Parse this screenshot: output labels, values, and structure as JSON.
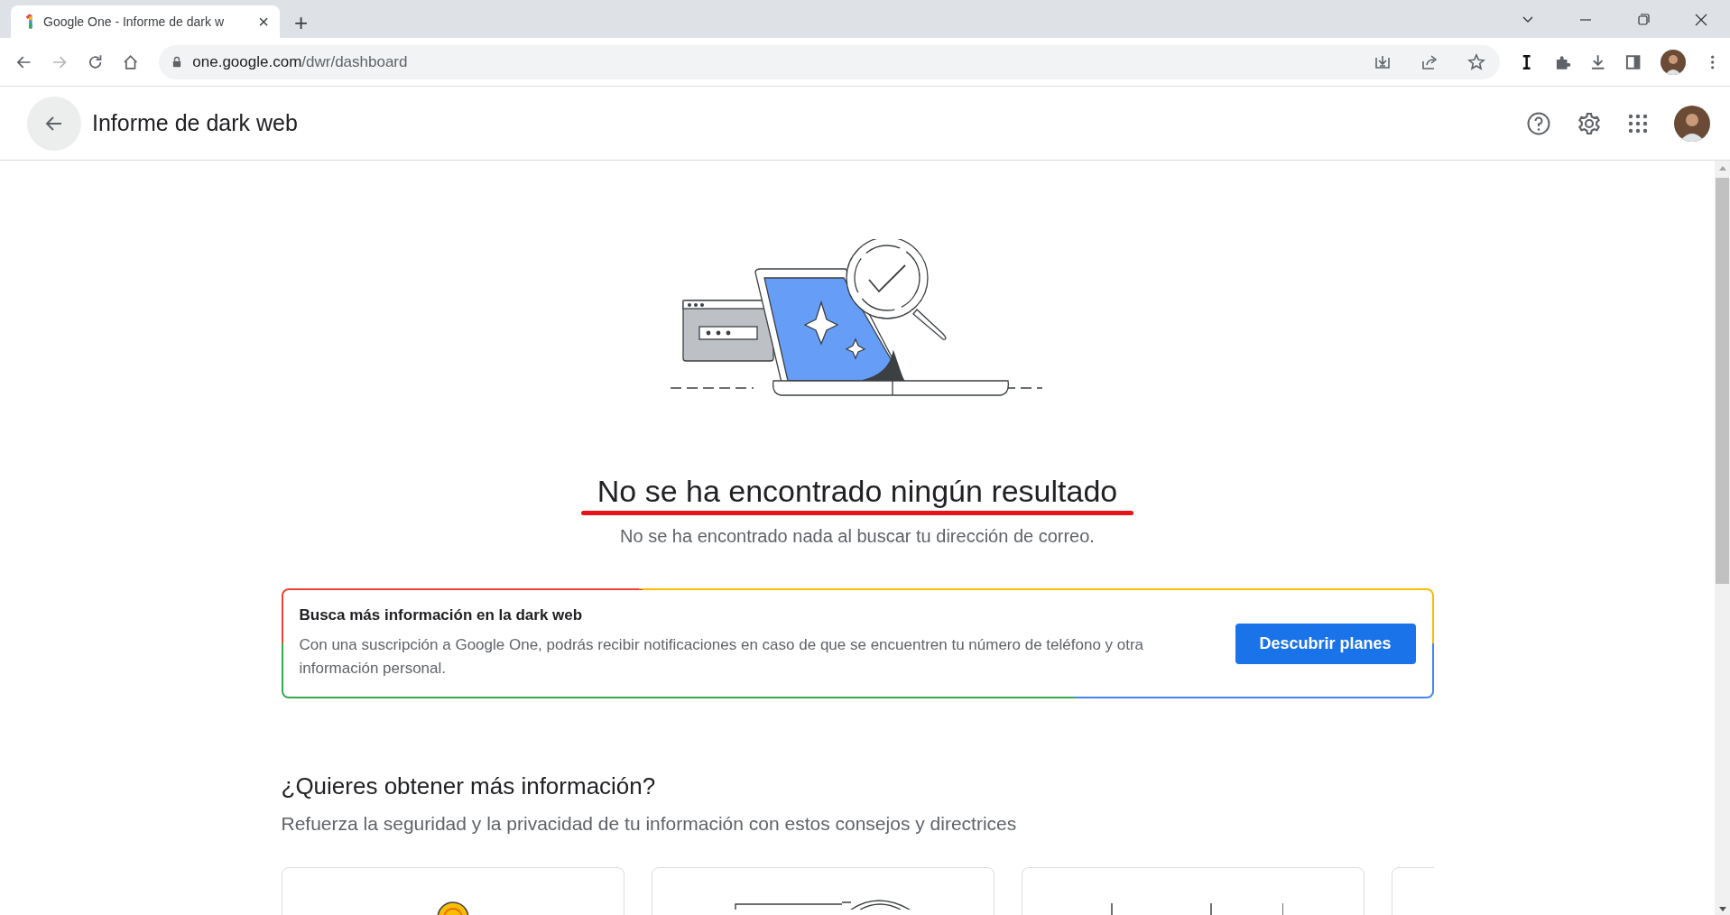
{
  "browser": {
    "tab": {
      "title": "Google One - Informe de dark w",
      "close": "×",
      "selected": true
    },
    "new_tab": "+",
    "url": {
      "domain": "one.google.com",
      "path": "/dwr/dashboard"
    }
  },
  "header": {
    "title": "Informe de dark web"
  },
  "result": {
    "title": "No se ha encontrado ningún resultado",
    "subtitle": "No se ha encontrado nada al buscar tu dirección de correo.",
    "underlined": true
  },
  "promo": {
    "title": "Busca más información en la dark web",
    "text": "Con una suscripción a Google One, podrás recibir notificaciones en caso de que se encuentren tu número de teléfono y otra información personal.",
    "button": "Descubrir planes"
  },
  "more_info": {
    "title": "¿Quieres obtener más información?",
    "subtitle": "Refuerza la seguridad y la privacidad de tu información con estos consejos y directrices",
    "cards": [
      {
        "kind": "coin"
      },
      {
        "kind": "device"
      },
      {
        "kind": "bars"
      },
      {
        "kind": "blank"
      }
    ]
  }
}
